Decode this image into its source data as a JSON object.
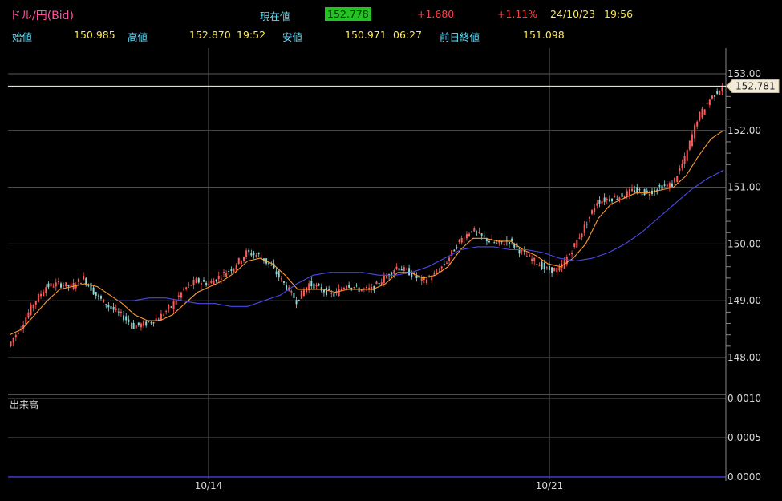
{
  "header": {
    "pair": "ドル/円(Bid)",
    "current_label": "現在値",
    "current_value": "152.778",
    "change": "+1.680",
    "change_pct": "+1.11%",
    "date": "24/10/23",
    "time": "19:56",
    "open_label": "始値",
    "open_value": "150.985",
    "high_label": "高値",
    "high_value": "152.870",
    "high_time": "19:52",
    "low_label": "安値",
    "low_value": "150.971",
    "low_time": "06:27",
    "prev_close_label": "前日終値",
    "prev_close_value": "151.098"
  },
  "colors": {
    "up_candle": "#ff5a5a",
    "down_candle": "#8fd8d8",
    "ma_short": "#ff9a2e",
    "ma_long": "#4a4ae8",
    "current_highlight": "#22c322"
  },
  "chart_data": [
    {
      "type": "line",
      "title": "ドル/円(Bid)",
      "x_tick_labels": [
        "10/14",
        "10/21"
      ],
      "y_tick_labels": [
        "148.00",
        "149.00",
        "150.00",
        "151.00",
        "152.00",
        "153.00"
      ],
      "ylim": [
        147.95,
        153.3
      ],
      "price_tag": "152.781",
      "grid": true,
      "series": [
        {
          "values": [
            148.2,
            148.55,
            148.95,
            149.25,
            149.3,
            149.25,
            149.4,
            149.1,
            148.9,
            148.75,
            148.55,
            148.6,
            148.7,
            148.9,
            149.2,
            149.35,
            149.3,
            149.45,
            149.6,
            149.85,
            149.8,
            149.6,
            149.3,
            149.0,
            149.3,
            149.2,
            149.1,
            149.3,
            149.2,
            149.2,
            149.4,
            149.6,
            149.5,
            149.35,
            149.45,
            149.7,
            150.05,
            150.25,
            150.1,
            150.0,
            150.05,
            149.85,
            149.7,
            149.55,
            149.55,
            149.9,
            150.3,
            150.75,
            150.8,
            150.85,
            150.95,
            150.9,
            151.0,
            151.05,
            151.5,
            152.2,
            152.55,
            152.78
          ]
        },
        {
          "name": "ma_short",
          "values": [
            148.4,
            148.5,
            148.75,
            149.0,
            149.2,
            149.25,
            149.3,
            149.25,
            149.1,
            148.95,
            148.75,
            148.65,
            148.65,
            148.75,
            148.95,
            149.15,
            149.25,
            149.35,
            149.5,
            149.7,
            149.75,
            149.65,
            149.45,
            149.2,
            149.2,
            149.2,
            149.15,
            149.2,
            149.2,
            149.2,
            149.3,
            149.5,
            149.5,
            149.4,
            149.45,
            149.6,
            149.9,
            150.1,
            150.1,
            150.05,
            150.05,
            149.9,
            149.8,
            149.65,
            149.6,
            149.75,
            150.0,
            150.45,
            150.7,
            150.8,
            150.9,
            150.9,
            150.95,
            151.0,
            151.2,
            151.55,
            151.85,
            152.0
          ]
        },
        {
          "name": "ma_long",
          "values": [
            149.0,
            149.0,
            149.05,
            149.05,
            149.0,
            148.95,
            148.95,
            148.9,
            148.9,
            149.0,
            149.1,
            149.3,
            149.45,
            149.5,
            149.5,
            149.5,
            149.45,
            149.45,
            149.5,
            149.6,
            149.75,
            149.9,
            149.95,
            149.95,
            149.9,
            149.9,
            149.85,
            149.75,
            149.7,
            149.75,
            149.85,
            150.0,
            150.2,
            150.45,
            150.7,
            150.95,
            151.15,
            151.3
          ]
        }
      ]
    },
    {
      "type": "bar",
      "title": "出来高",
      "y_tick_labels": [
        "0.0000",
        "0.0005",
        "0.0010"
      ],
      "ylim": [
        0,
        0.001
      ]
    }
  ]
}
